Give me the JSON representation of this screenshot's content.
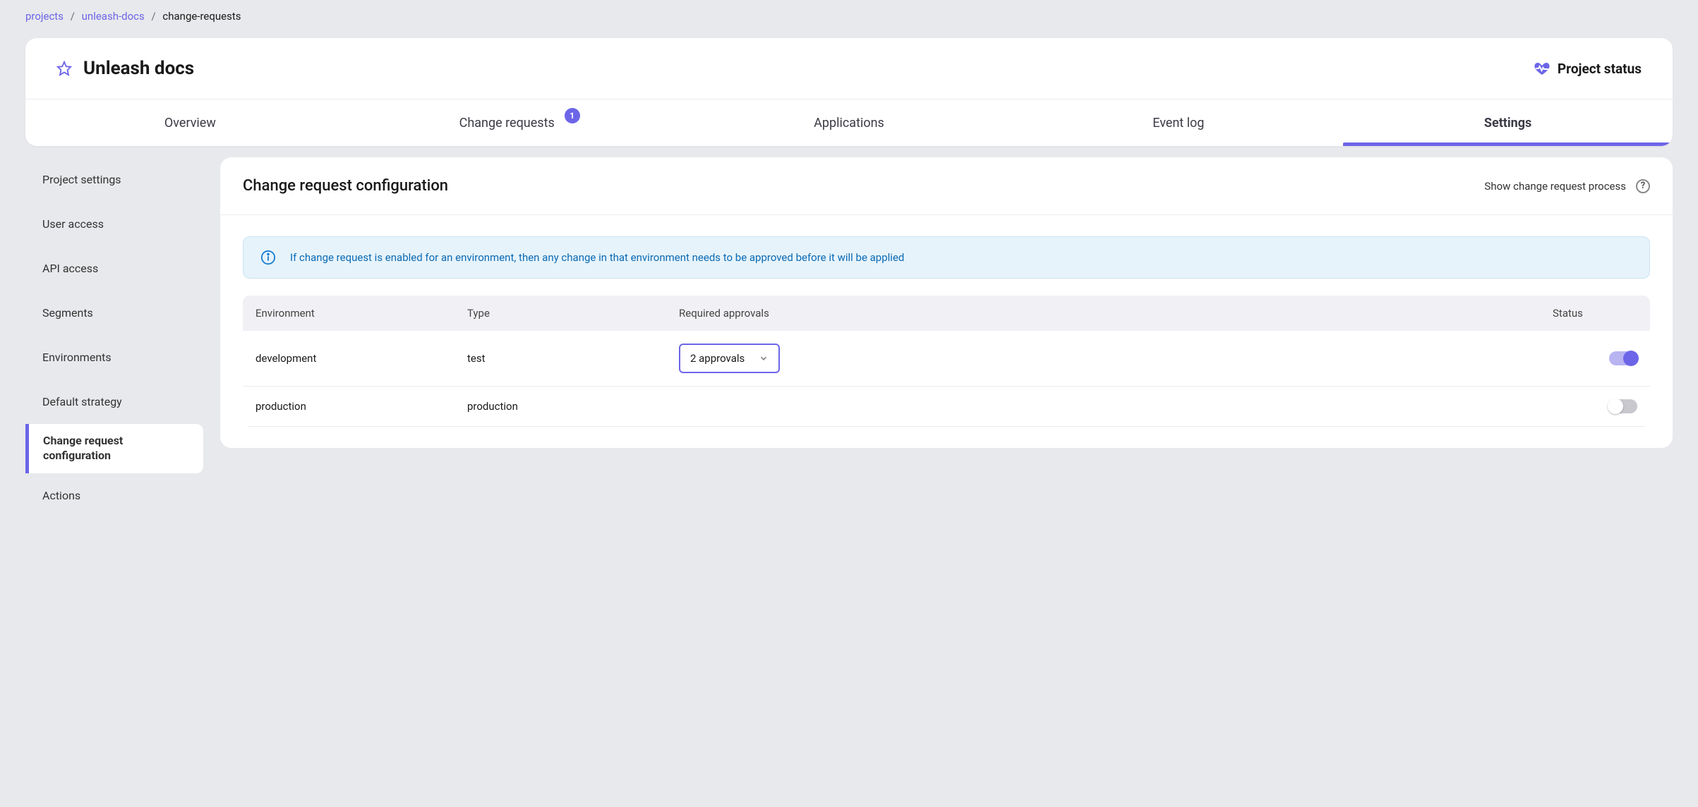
{
  "breadcrumb": {
    "l1": "projects",
    "l2": "unleash-docs",
    "l3": "change-requests"
  },
  "header": {
    "title": "Unleash docs",
    "project_status": "Project status"
  },
  "tabs": {
    "overview": "Overview",
    "change_requests": "Change requests",
    "change_requests_badge": "1",
    "applications": "Applications",
    "event_log": "Event log",
    "settings": "Settings"
  },
  "sidebar": {
    "project_settings": "Project settings",
    "user_access": "User access",
    "api_access": "API access",
    "segments": "Segments",
    "environments": "Environments",
    "default_strategy": "Default strategy",
    "change_request_config": "Change request configuration",
    "actions": "Actions"
  },
  "panel": {
    "title": "Change request configuration",
    "show_process": "Show change request process",
    "info": "If change request is enabled for an environment, then any change in that environment needs to be approved before it will be applied"
  },
  "table": {
    "head": {
      "env": "Environment",
      "type": "Type",
      "req": "Required approvals",
      "status": "Status"
    },
    "rows": [
      {
        "env": "development",
        "type": "test",
        "approvals": "2 approvals",
        "status_on": true
      },
      {
        "env": "production",
        "type": "production",
        "approvals": "",
        "status_on": false
      }
    ]
  }
}
